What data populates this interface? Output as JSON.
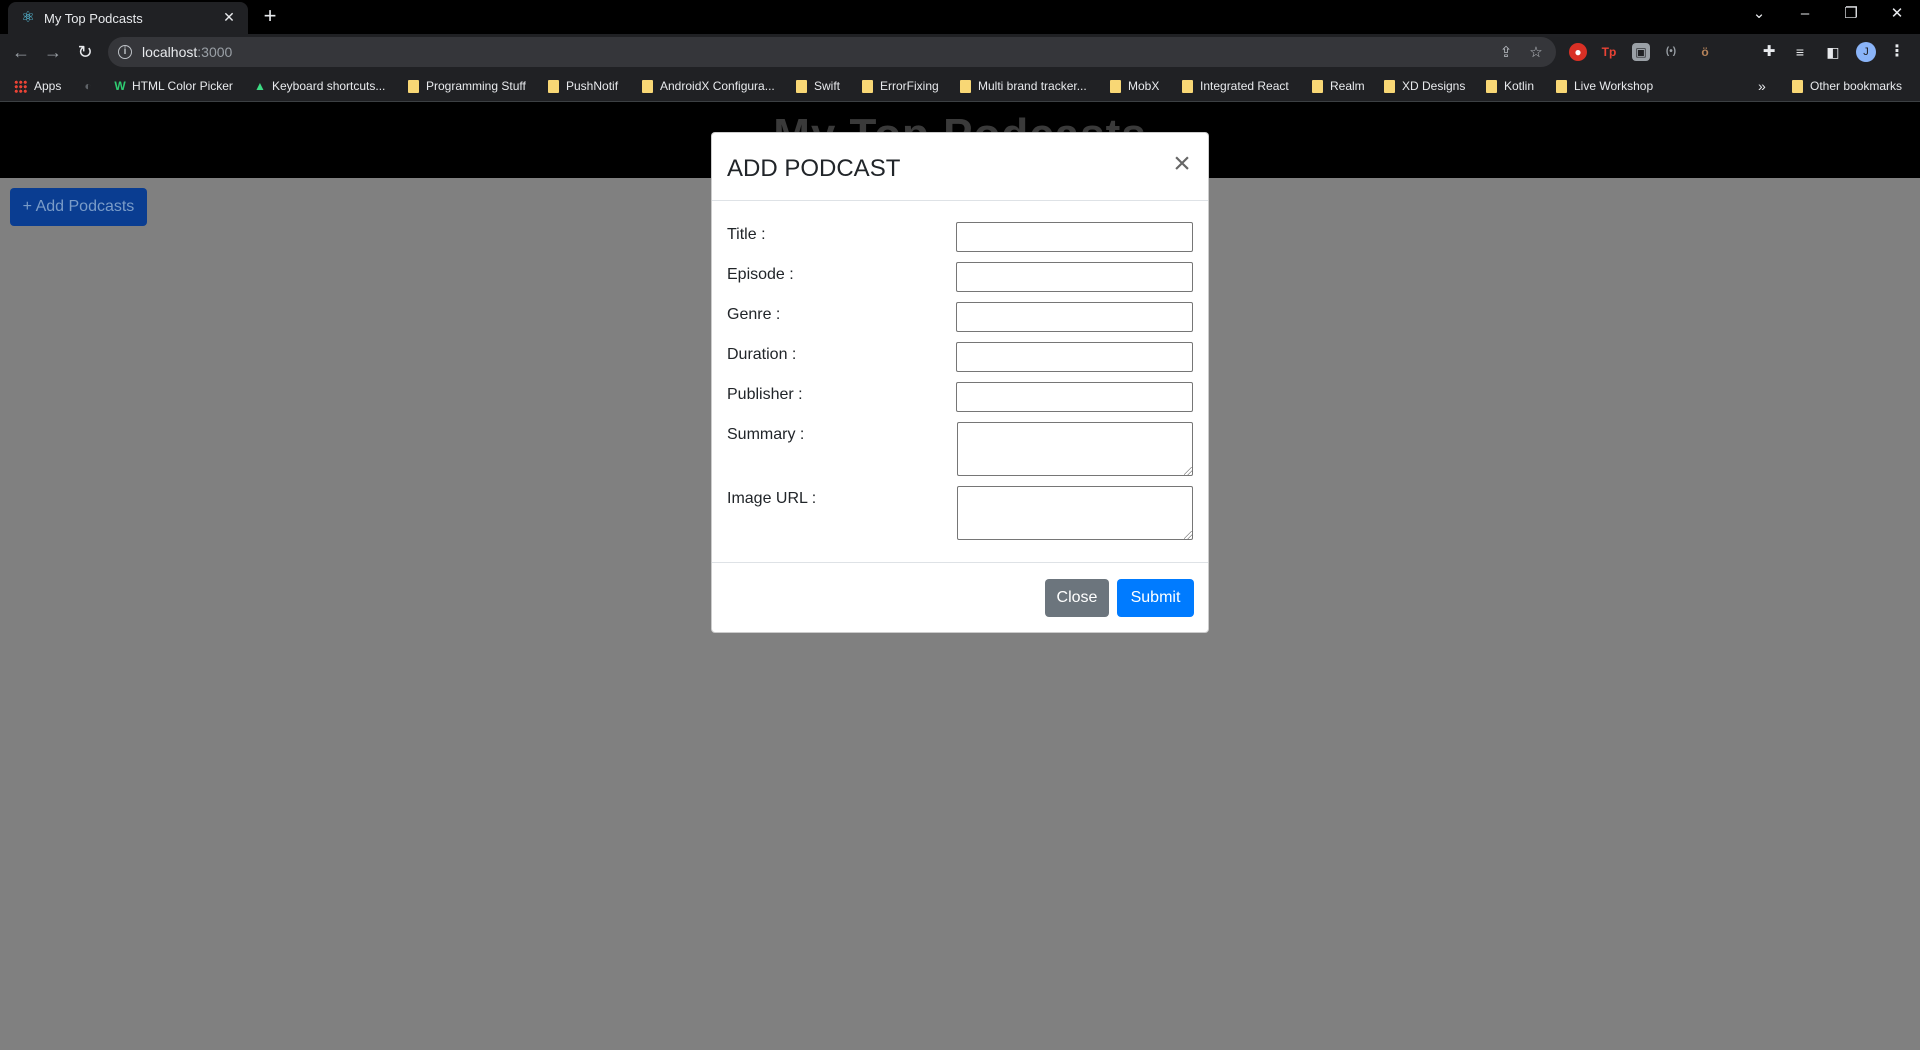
{
  "browser": {
    "tab": {
      "title": "My Top Podcasts",
      "favicon": "react-icon"
    },
    "address": {
      "host": "localhost",
      "port": ":3000"
    },
    "profile_initial": "J",
    "bookmarks": [
      {
        "label": "Apps",
        "icon": "apps-grid-icon"
      },
      {
        "label": "",
        "icon": "globe-icon"
      },
      {
        "label": "HTML Color Picker",
        "icon": "w-icon"
      },
      {
        "label": "Keyboard shortcuts...",
        "icon": "android-icon"
      },
      {
        "label": "Programming Stuff",
        "icon": "folder-icon"
      },
      {
        "label": "PushNotif",
        "icon": "folder-icon"
      },
      {
        "label": "AndroidX Configura...",
        "icon": "folder-icon"
      },
      {
        "label": "Swift",
        "icon": "folder-icon"
      },
      {
        "label": "ErrorFixing",
        "icon": "folder-icon"
      },
      {
        "label": "Multi brand tracker...",
        "icon": "folder-icon"
      },
      {
        "label": "MobX",
        "icon": "folder-icon"
      },
      {
        "label": "Integrated React",
        "icon": "folder-icon"
      },
      {
        "label": "Realm",
        "icon": "folder-icon"
      },
      {
        "label": "XD Designs",
        "icon": "folder-icon"
      },
      {
        "label": "Kotlin",
        "icon": "folder-icon"
      },
      {
        "label": "Live Workshop",
        "icon": "folder-icon"
      }
    ],
    "bookmarks_overflow": "»",
    "other_bookmarks": "Other bookmarks"
  },
  "page": {
    "header_title": "My Top Podcasts",
    "add_button": "+ Add Podcasts"
  },
  "modal": {
    "title": "ADD PODCAST",
    "close_icon": "×",
    "fields": [
      {
        "label": "Title :",
        "value": ""
      },
      {
        "label": "Episode :",
        "value": ""
      },
      {
        "label": "Genre :",
        "value": ""
      },
      {
        "label": "Duration :",
        "value": ""
      },
      {
        "label": "Publisher :",
        "value": ""
      },
      {
        "label": "Summary :",
        "value": ""
      },
      {
        "label": "Image URL :",
        "value": ""
      }
    ],
    "close_button": "Close",
    "submit_button": "Submit"
  },
  "colors": {
    "submit": "#007bff",
    "close": "#6c757d",
    "backdrop": "#808080"
  }
}
